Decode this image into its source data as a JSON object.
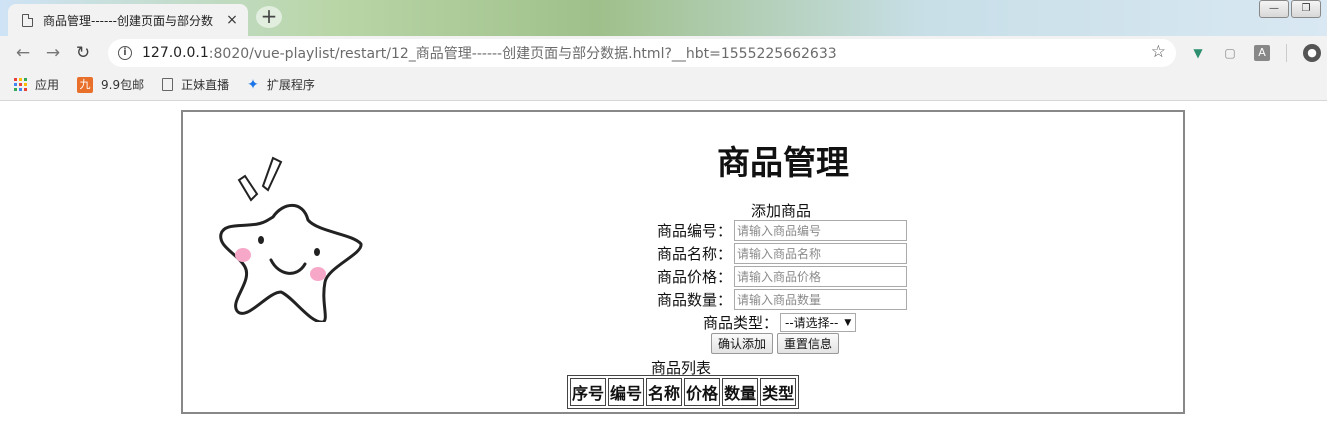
{
  "browser": {
    "tab_title": "商品管理------创建页面与部分数",
    "tab_close": "×",
    "new_tab": "+",
    "url_host": "127.0.0.1",
    "url_rest": ":8020/vue-playlist/restart/12_商品管理------创建页面与部分数据.html?__hbt=1555225662633",
    "icons": [
      "back-icon",
      "forward-icon",
      "reload-icon",
      "info-icon",
      "star-icon",
      "vue-devtools-icon",
      "lock-icon",
      "translate-icon",
      "account-icon"
    ],
    "bookmarks": [
      {
        "label": "应用",
        "icon": "apps-icon"
      },
      {
        "label": "9.9包邮",
        "icon": "jiu-icon",
        "icon_text": "九"
      },
      {
        "label": "正妹直播",
        "icon": "page-icon"
      },
      {
        "label": "扩展程序",
        "icon": "puzzle-icon"
      }
    ]
  },
  "page": {
    "title": "商品管理",
    "form": {
      "caption": "添加商品",
      "fields": [
        {
          "label": "商品编号：",
          "placeholder": "请输入商品编号"
        },
        {
          "label": "商品名称：",
          "placeholder": "请输入商品名称"
        },
        {
          "label": "商品价格：",
          "placeholder": "请输入商品价格"
        },
        {
          "label": "商品数量：",
          "placeholder": "请输入商品数量"
        }
      ],
      "type_label": "商品类型：",
      "type_selected": "--请选择--",
      "confirm_label": "确认添加",
      "reset_label": "重置信息"
    },
    "table": {
      "caption": "商品列表",
      "headers": [
        "序号",
        "编号",
        "名称",
        "价格",
        "数量",
        "类型"
      ]
    }
  },
  "colors": {
    "frame_border": "#888888",
    "star_cheek": "#f7a8c8"
  }
}
